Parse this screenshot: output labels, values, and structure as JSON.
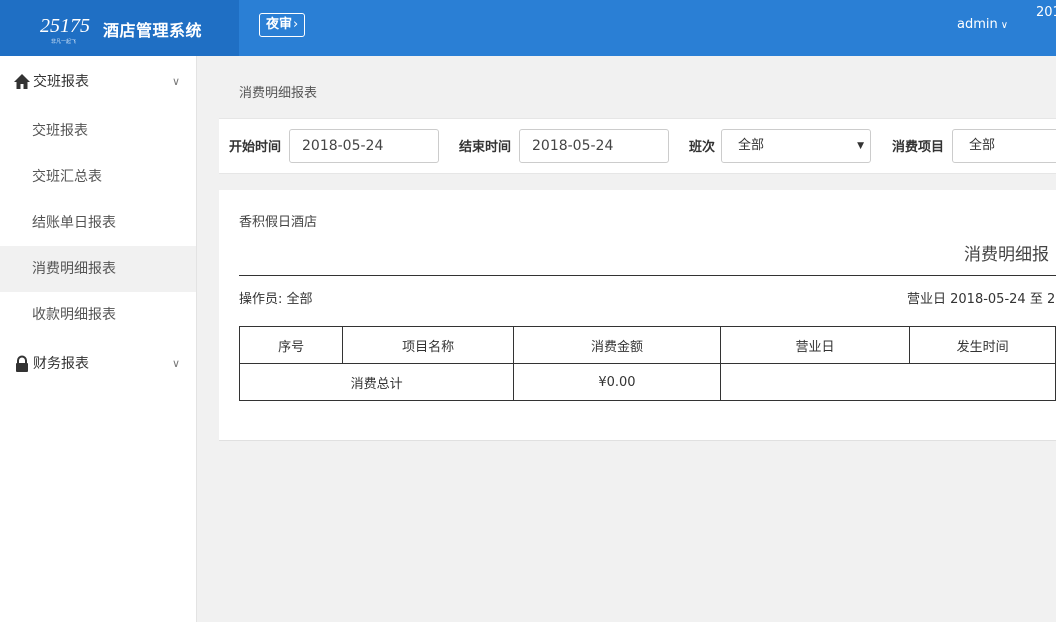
{
  "header": {
    "logo_text": "25175",
    "logo_sub": "非凡一起飞",
    "title": "酒店管理系统",
    "night_audit_label": "夜审",
    "user": "admin",
    "clock_partial": "201"
  },
  "sidebar": {
    "groups": [
      {
        "label": "交班报表",
        "icon": "home-icon",
        "items": [
          {
            "label": "交班报表"
          },
          {
            "label": "交班汇总表"
          },
          {
            "label": "结账单日报表"
          },
          {
            "label": "消费明细报表"
          },
          {
            "label": "收款明细报表"
          }
        ]
      },
      {
        "label": "财务报表",
        "icon": "lock-icon",
        "items": []
      }
    ],
    "active_item": "消费明细报表"
  },
  "breadcrumb": "消费明细报表",
  "filters": {
    "start_label": "开始时间",
    "start_value": "2018-05-24",
    "end_label": "结束时间",
    "end_value": "2018-05-24",
    "shift_label": "班次",
    "shift_value": "全部",
    "item_label": "消费项目",
    "item_value": "全部"
  },
  "report": {
    "hotel": "香积假日酒店",
    "title": "消费明细报",
    "operator": "操作员: 全部",
    "business_day": "营业日 2018-05-24 至 2",
    "columns": [
      "序号",
      "项目名称",
      "消费金额",
      "营业日",
      "发生时间"
    ],
    "total_label": "消费总计",
    "total_amount": "¥0.00"
  },
  "colors": {
    "header": "#2a7fd5",
    "brand": "#1f6fc4",
    "active_bg": "#f1f1f1"
  }
}
